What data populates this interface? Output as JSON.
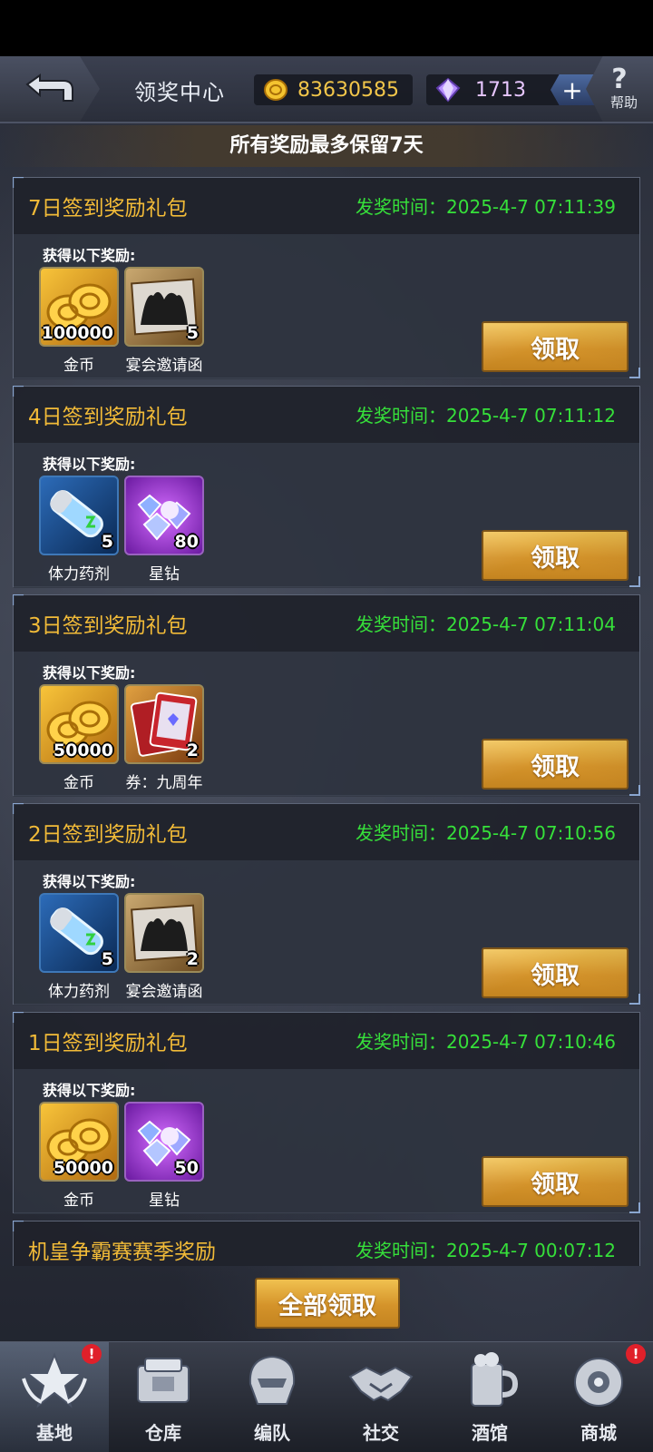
{
  "header": {
    "title": "领奖中心",
    "coins": "83630585",
    "gems": "1713",
    "plus": "+",
    "help_label": "帮助"
  },
  "notice": "所有奖励最多保留7天",
  "common": {
    "gain_label": "获得以下奖励:",
    "claim_label": "领取"
  },
  "rewards": [
    {
      "title": "7日签到奖励礼包",
      "time": "发奖时间：2025-4-7 07:11:39",
      "items": [
        {
          "name": "金币",
          "count": "100000",
          "icon": "gold-coins-icon"
        },
        {
          "name": "宴会邀请函",
          "count": "5",
          "icon": "invitation-card-icon"
        }
      ]
    },
    {
      "title": "4日签到奖励礼包",
      "time": "发奖时间：2025-4-7 07:11:12",
      "items": [
        {
          "name": "体力药剂",
          "count": "5",
          "icon": "stamina-potion-icon"
        },
        {
          "name": "星钻",
          "count": "80",
          "icon": "star-diamond-icon"
        }
      ]
    },
    {
      "title": "3日签到奖励礼包",
      "time": "发奖时间：2025-4-7 07:11:04",
      "items": [
        {
          "name": "金币",
          "count": "50000",
          "icon": "gold-coins-icon"
        },
        {
          "name": "券：九周年",
          "count": "2",
          "icon": "ticket-card-icon"
        }
      ]
    },
    {
      "title": "2日签到奖励礼包",
      "time": "发奖时间：2025-4-7 07:10:56",
      "items": [
        {
          "name": "体力药剂",
          "count": "5",
          "icon": "stamina-potion-icon"
        },
        {
          "name": "宴会邀请函",
          "count": "2",
          "icon": "invitation-card-icon"
        }
      ]
    },
    {
      "title": "1日签到奖励礼包",
      "time": "发奖时间：2025-4-7 07:10:46",
      "items": [
        {
          "name": "金币",
          "count": "50000",
          "icon": "gold-coins-icon"
        },
        {
          "name": "星钻",
          "count": "50",
          "icon": "star-diamond-icon"
        }
      ]
    },
    {
      "title": "机皇争霸赛赛季奖励",
      "time": "发奖时间：2025-4-7 00:07:12",
      "items": []
    }
  ],
  "claim_all_label": "全部领取",
  "nav": [
    {
      "label": "基地",
      "badge": "!"
    },
    {
      "label": "仓库",
      "badge": ""
    },
    {
      "label": "编队",
      "badge": ""
    },
    {
      "label": "社交",
      "badge": ""
    },
    {
      "label": "酒馆",
      "badge": ""
    },
    {
      "label": "商城",
      "badge": "!"
    }
  ]
}
